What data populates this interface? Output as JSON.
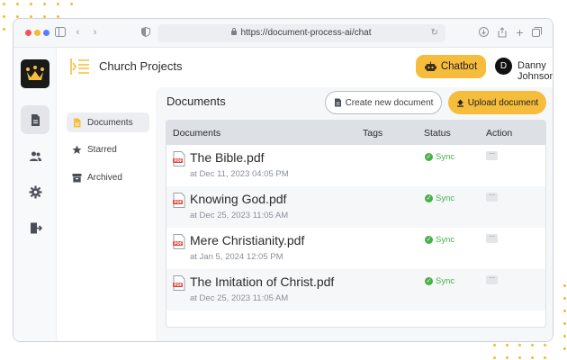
{
  "browser": {
    "url": "https://document-process-ai/chat"
  },
  "header": {
    "project_title": "Church Projects",
    "chatbot_label": "Chatbot",
    "user_initial": "D",
    "user_name": "Danny Johnson"
  },
  "subnav": {
    "items": [
      {
        "label": "Documents",
        "icon": "document-icon",
        "active": true
      },
      {
        "label": "Starred",
        "icon": "star-icon",
        "active": false
      },
      {
        "label": "Archived",
        "icon": "archive-icon",
        "active": false
      }
    ]
  },
  "main": {
    "title": "Documents",
    "new_doc_label": "Create new document",
    "upload_label": "Upload document",
    "columns": [
      "Documents",
      "Tags",
      "Status",
      "Action"
    ],
    "rows": [
      {
        "name": "The Bible.pdf",
        "date": "at Dec 11, 2023 04:05 PM",
        "tags": "",
        "status": "Sync",
        "action": "···"
      },
      {
        "name": "Knowing God.pdf",
        "date": "at Dec 25, 2023 11:05 AM",
        "tags": "",
        "status": "Sync",
        "action": "···"
      },
      {
        "name": "Mere Christianity.pdf",
        "date": "at Jan 5, 2024 12:05 PM",
        "tags": "",
        "status": "Sync",
        "action": "···"
      },
      {
        "name": "The Imitation of Christ.pdf",
        "date": "at Dec 25, 2023 11:05 AM",
        "tags": "",
        "status": "Sync",
        "action": "···"
      }
    ]
  },
  "colors": {
    "accent": "#f6bd3d",
    "sync_green": "#48b04a",
    "pdf_red": "#d9413a"
  }
}
